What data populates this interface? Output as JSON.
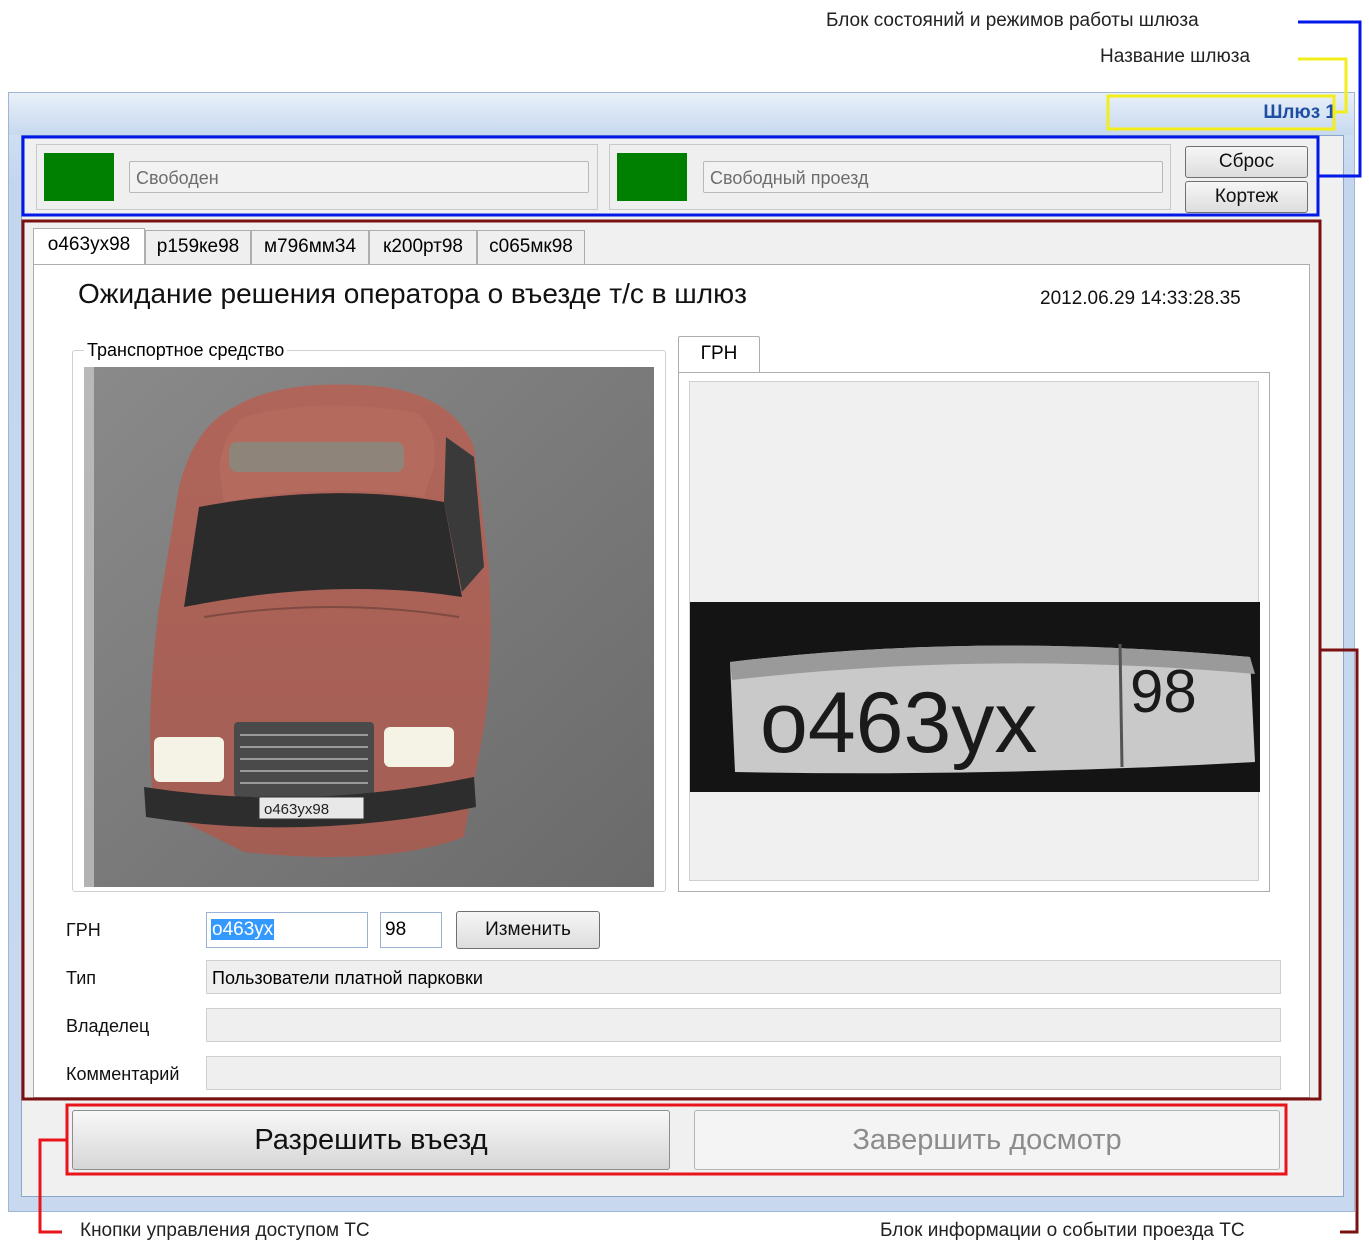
{
  "annotations": {
    "status_block": "Блок состояний и режимов работы шлюза",
    "gate_name": "Название шлюза",
    "access_buttons": "Кнопки управления доступом ТС",
    "event_info": "Блок информации о событии проезда ТС"
  },
  "window": {
    "gate_name": "Шлюз 1"
  },
  "status": {
    "state": "Свободен",
    "mode": "Свободный проезд",
    "state_color": "#008000",
    "mode_color": "#008000",
    "reset_label": "Сброс",
    "cortege_label": "Кортеж"
  },
  "plate_tabs": [
    "о463ух98",
    "р159ке98",
    "м796мм34",
    "к200рт98",
    "с065мк98"
  ],
  "event": {
    "title": "Ожидание решения оператора о въезде т/с в шлюз",
    "timestamp": "2012.06.29 14:33:28.35",
    "vehicle_group": "Транспортное средство",
    "plate_tab": "ГРН",
    "car_plate_text": "о463ух98",
    "plate_image": {
      "main": "о463ух",
      "region": "98"
    }
  },
  "form": {
    "grn_label": "ГРН",
    "grn_value": "о463ух",
    "region_value": "98",
    "change_button": "Изменить",
    "type_label": "Тип",
    "type_value": "Пользователи платной парковки",
    "owner_label": "Владелец",
    "owner_value": "",
    "comment_label": "Комментарий",
    "comment_value": ""
  },
  "actions": {
    "allow_entry": "Разрешить въезд",
    "finish_inspection": "Завершить досмотр"
  }
}
